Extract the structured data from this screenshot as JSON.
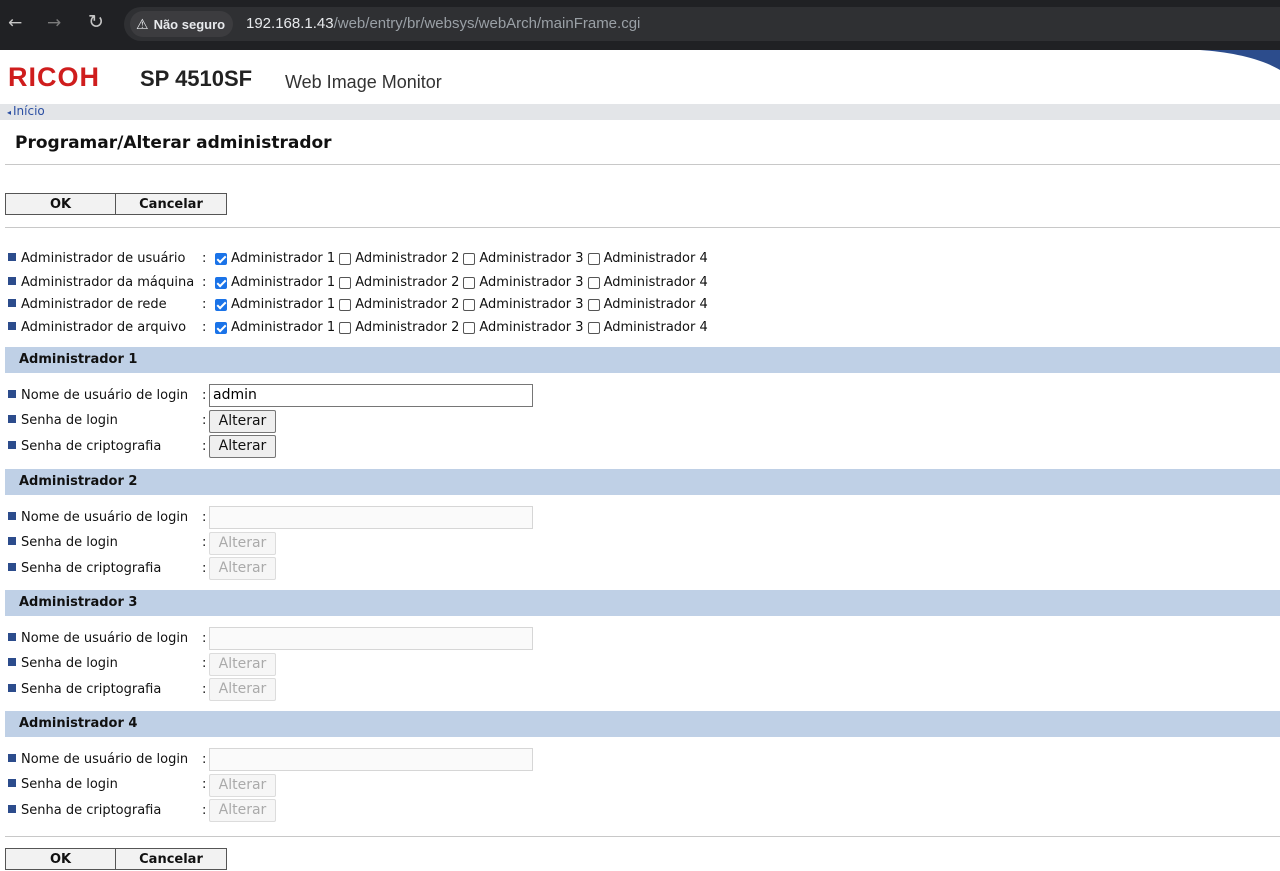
{
  "browser": {
    "back_glyph": "←",
    "forward_glyph": "→",
    "reload_glyph": "↻",
    "security_warning": "⚠",
    "security_label": "Não seguro",
    "url_host": "192.168.1.43",
    "url_path": "/web/entry/br/websys/webArch/mainFrame.cgi"
  },
  "header": {
    "brand": "RICOH",
    "model": "SP 4510SF",
    "app_name": "Web Image Monitor",
    "brand_color": "#cf1d1d"
  },
  "breadcrumb": {
    "arrow": "◂",
    "home_label": "Início"
  },
  "page": {
    "title": "Programar/Alterar administrador"
  },
  "actions": {
    "ok_label": "OK",
    "cancel_label": "Cancelar"
  },
  "assignments": [
    {
      "label": "Administrador de usuário",
      "colon": ":",
      "options": [
        "Administrador 1",
        "Administrador 2",
        "Administrador 3",
        "Administrador 4"
      ],
      "checked": [
        true,
        false,
        false,
        false
      ]
    },
    {
      "label": "Administrador da máquina",
      "colon": ":",
      "options": [
        "Administrador 1",
        "Administrador 2",
        "Administrador 3",
        "Administrador 4"
      ],
      "checked": [
        true,
        false,
        false,
        false
      ]
    },
    {
      "label": "Administrador de rede",
      "colon": ":",
      "options": [
        "Administrador 1",
        "Administrador 2",
        "Administrador 3",
        "Administrador 4"
      ],
      "checked": [
        true,
        false,
        false,
        false
      ]
    },
    {
      "label": "Administrador de arquivo",
      "colon": ":",
      "options": [
        "Administrador 1",
        "Administrador 2",
        "Administrador 3",
        "Administrador 4"
      ],
      "checked": [
        true,
        false,
        false,
        false
      ]
    }
  ],
  "admins": [
    {
      "title": "Administrador 1",
      "username_label": "Nome de usuário de login",
      "username_value": "admin",
      "login_pw_label": "Senha de login",
      "crypto_pw_label": "Senha de criptografia",
      "change_label": "Alterar",
      "colon": ":",
      "enabled": true
    },
    {
      "title": "Administrador 2",
      "username_label": "Nome de usuário de login",
      "username_value": "",
      "login_pw_label": "Senha de login",
      "crypto_pw_label": "Senha de criptografia",
      "change_label": "Alterar",
      "colon": ":",
      "enabled": false
    },
    {
      "title": "Administrador 3",
      "username_label": "Nome de usuário de login",
      "username_value": "",
      "login_pw_label": "Senha de login",
      "crypto_pw_label": "Senha de criptografia",
      "change_label": "Alterar",
      "colon": ":",
      "enabled": false
    },
    {
      "title": "Administrador 4",
      "username_label": "Nome de usuário de login",
      "username_value": "",
      "login_pw_label": "Senha de login",
      "crypto_pw_label": "Senha de criptografia",
      "change_label": "Alterar",
      "colon": ":",
      "enabled": false
    }
  ]
}
